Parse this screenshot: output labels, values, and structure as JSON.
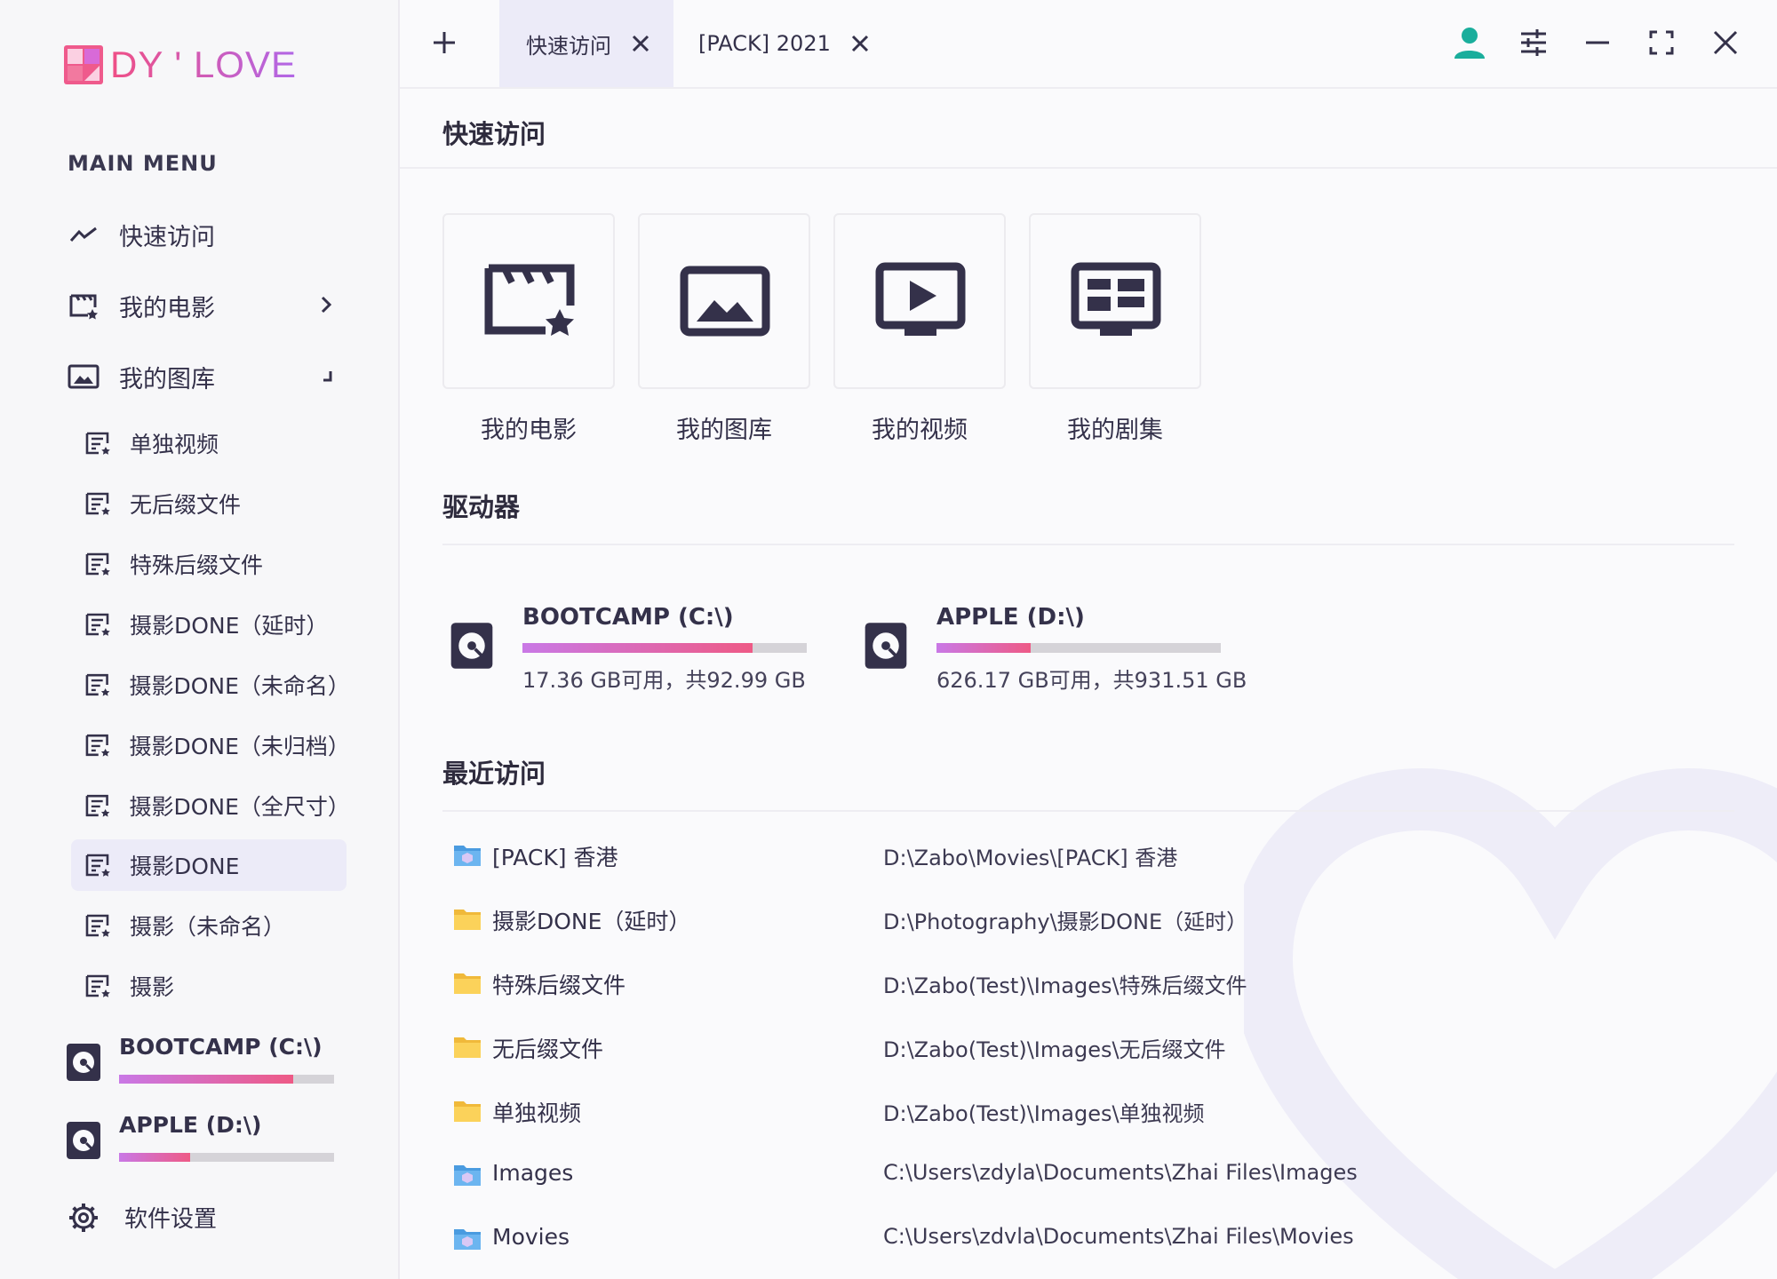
{
  "app": {
    "logo_text": "DY ' LOVE",
    "brand_colors": {
      "pink": "#ef4f86",
      "purple": "#b167e7",
      "accent_bg": "#ecebf8"
    }
  },
  "sidebar": {
    "menu_title": "MAIN MENU",
    "nav": [
      {
        "label": "快速访问",
        "icon": "trend-icon"
      },
      {
        "label": "我的电影",
        "icon": "movie-icon"
      },
      {
        "label": "我的图库",
        "icon": "gallery-icon"
      }
    ],
    "sub_items": [
      {
        "label": "单独视频"
      },
      {
        "label": "无后缀文件"
      },
      {
        "label": "特殊后缀文件"
      },
      {
        "label": "摄影DONE（延时）"
      },
      {
        "label": "摄影DONE（未命名）"
      },
      {
        "label": "摄影DONE（未归档）"
      },
      {
        "label": "摄影DONE（全尺寸）"
      },
      {
        "label": "摄影DONE",
        "active": true
      },
      {
        "label": "摄影（未命名）"
      },
      {
        "label": "摄影"
      }
    ],
    "drives": [
      {
        "name": "BOOTCAMP (C:\\)",
        "used_fraction": 0.81
      },
      {
        "name": "APPLE (D:\\)",
        "used_fraction": 0.33
      }
    ],
    "settings_label": "软件设置"
  },
  "tabs": [
    {
      "label": "快速访问",
      "active": true
    },
    {
      "label": "[PACK] 2021",
      "active": false
    }
  ],
  "content": {
    "quick_access_title": "快速访问",
    "quick_cards": [
      {
        "label": "我的电影",
        "icon": "movie-icon"
      },
      {
        "label": "我的图库",
        "icon": "image-icon"
      },
      {
        "label": "我的视频",
        "icon": "video-icon"
      },
      {
        "label": "我的剧集",
        "icon": "tv-series-icon"
      }
    ],
    "drives_title": "驱动器",
    "drives": [
      {
        "name": "BOOTCAMP (C:\\)",
        "free": "17.36 GB可用，共92.99 GB",
        "used_fraction": 0.81
      },
      {
        "name": "APPLE (D:\\)",
        "free": "626.17 GB可用，共931.51 GB",
        "used_fraction": 0.33
      }
    ],
    "recent_title": "最近访问",
    "recent": [
      {
        "name": "[PACK] 香港",
        "path": "D:\\Zabo\\Movies\\[PACK] 香港",
        "icon": "pack-folder-icon"
      },
      {
        "name": "摄影DONE（延时）",
        "path": "D:\\Photography\\摄影DONE（延时）",
        "icon": "folder-icon"
      },
      {
        "name": "特殊后缀文件",
        "path": "D:\\Zabo(Test)\\Images\\特殊后缀文件",
        "icon": "folder-icon"
      },
      {
        "name": "无后缀文件",
        "path": "D:\\Zabo(Test)\\Images\\无后缀文件",
        "icon": "folder-icon"
      },
      {
        "name": "单独视频",
        "path": "D:\\Zabo(Test)\\Images\\单独视频",
        "icon": "folder-icon"
      },
      {
        "name": "Images",
        "path": "C:\\Users\\zdyla\\Documents\\Zhai Files\\Images",
        "icon": "pack-folder-icon"
      },
      {
        "name": "Movies",
        "path": "C:\\Users\\zdvla\\Documents\\Zhai Files\\Movies",
        "icon": "pack-folder-icon"
      }
    ]
  }
}
